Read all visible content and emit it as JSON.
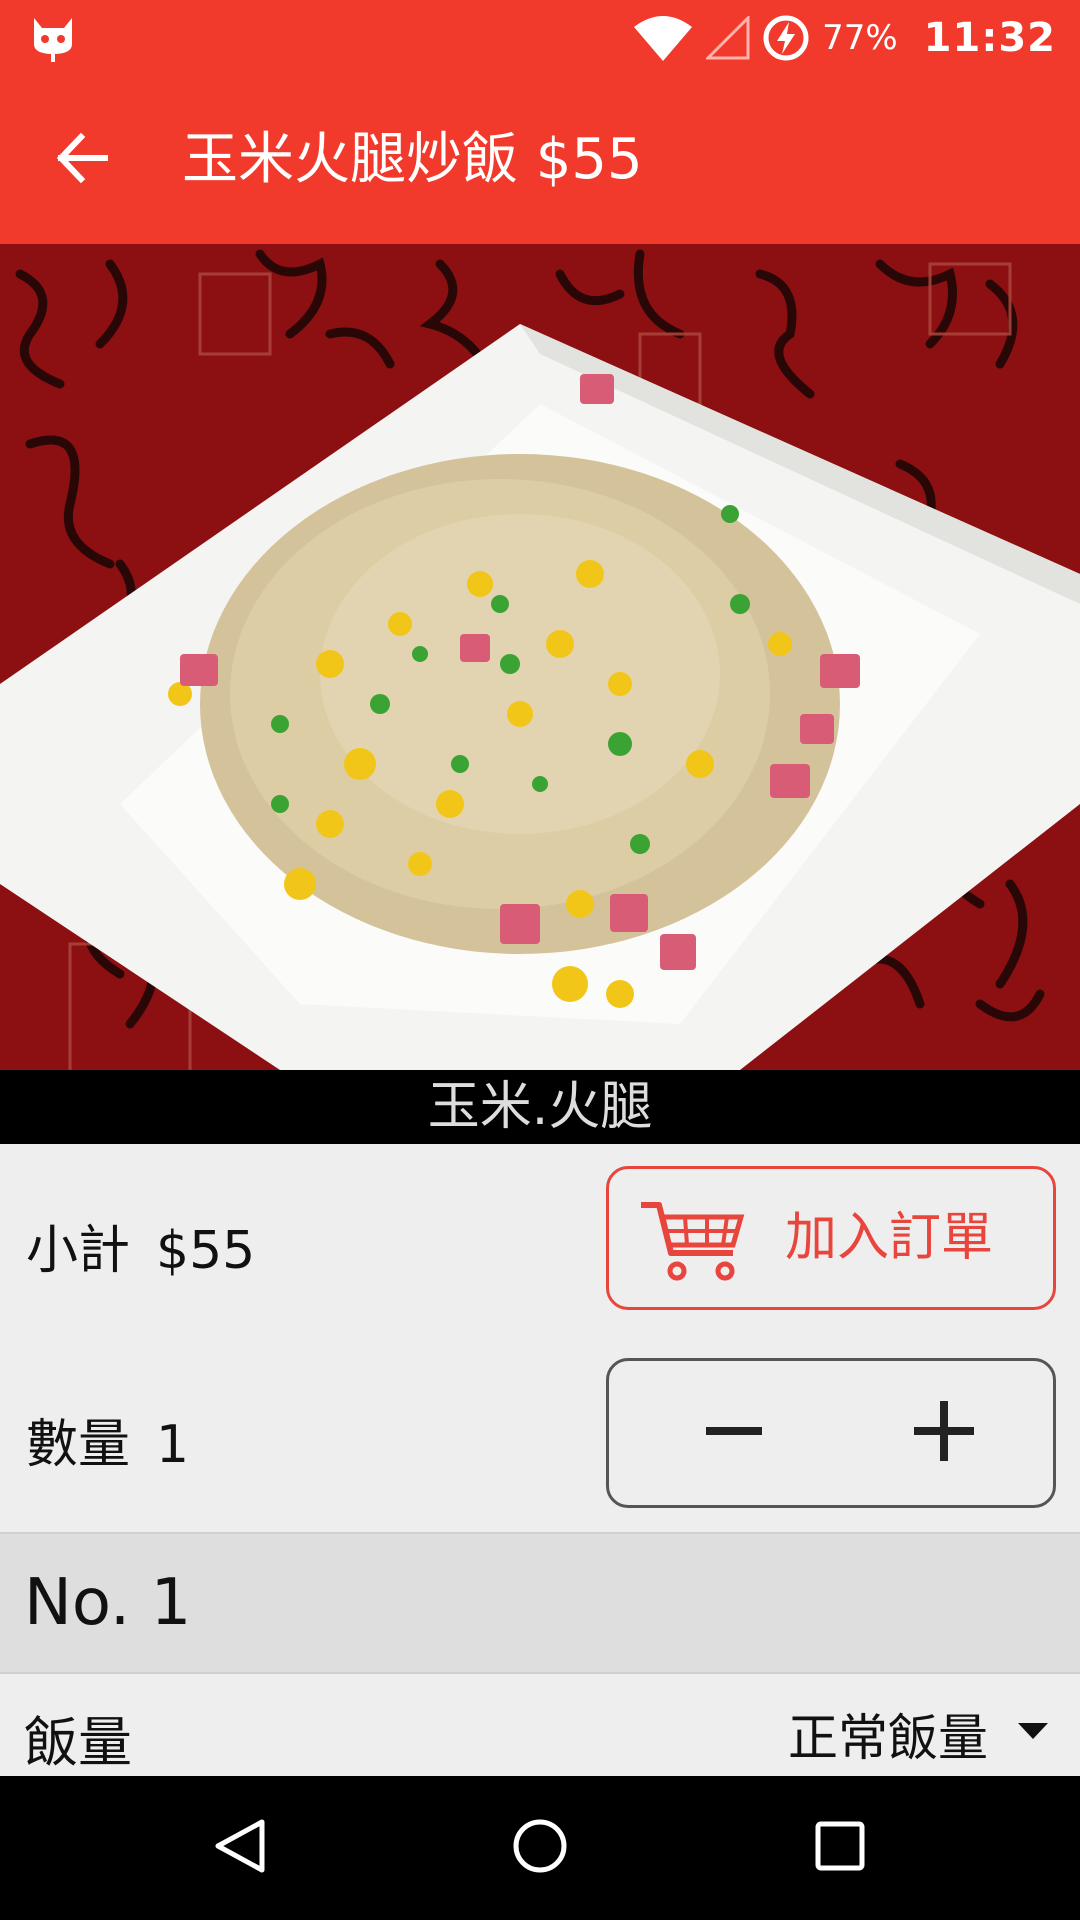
{
  "status_bar": {
    "battery_text": "77%",
    "time": "11:32",
    "icons": [
      "android-notification-icon",
      "wifi-icon",
      "signal-icon",
      "battery-charging-icon"
    ]
  },
  "app_bar": {
    "title": "玉米火腿炒飯 $55",
    "back_icon": "arrow-left-icon"
  },
  "hero": {
    "caption": "玉米.火腿"
  },
  "subtotal": {
    "label": "小計",
    "value": "$55"
  },
  "add_order": {
    "label": "加入訂單",
    "icon": "shopping-cart-icon"
  },
  "quantity": {
    "label": "數量",
    "value": "1",
    "minus_icon": "minus-icon",
    "plus_icon": "plus-icon"
  },
  "section": {
    "title": "No. 1"
  },
  "option": {
    "label": "飯量",
    "selected": "正常飯量",
    "icon": "dropdown-arrow-icon"
  },
  "nav_bar": {
    "icons": [
      "nav-back-icon",
      "nav-home-icon",
      "nav-recents-icon"
    ]
  },
  "colors": {
    "primary": "#f23a2c",
    "accent": "#e8453c",
    "header_bg": "#dedede",
    "page_bg": "#eeeeee"
  }
}
